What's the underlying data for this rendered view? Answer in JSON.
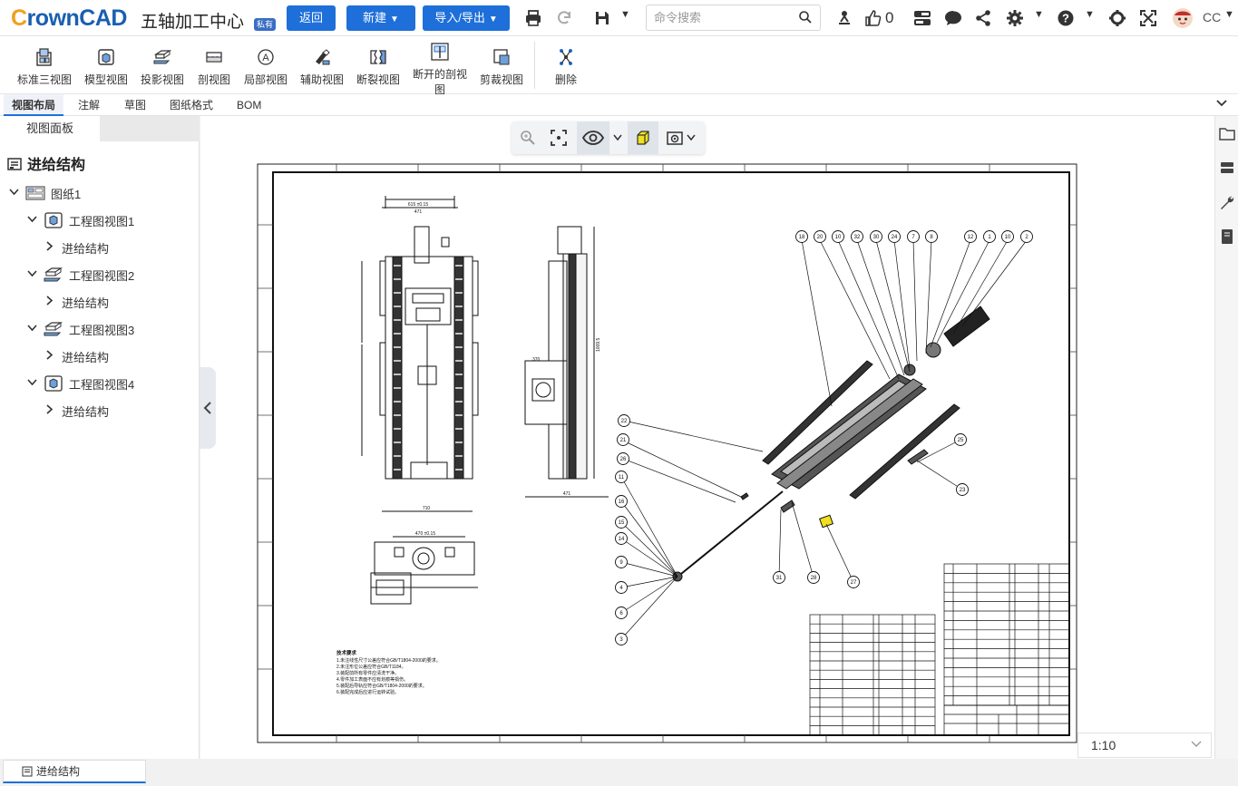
{
  "app": {
    "logo_c": "C",
    "logo_rest": "rownCAD",
    "title": "五轴加工中心",
    "badge": "私有"
  },
  "header": {
    "back_label": "返回",
    "new_label": "新建",
    "import_export_label": "导入/导出",
    "search_placeholder": "命令搜索",
    "like_count": "0",
    "user_name": "CC"
  },
  "toolbar": {
    "items": [
      {
        "label": "标准三视图",
        "icon": "standard-three-view-icon"
      },
      {
        "label": "模型视图",
        "icon": "model-view-icon"
      },
      {
        "label": "投影视图",
        "icon": "projection-view-icon"
      },
      {
        "label": "剖视图",
        "icon": "section-view-icon"
      },
      {
        "label": "局部视图",
        "icon": "detail-view-icon"
      },
      {
        "label": "辅助视图",
        "icon": "auxiliary-view-icon"
      },
      {
        "label": "断裂视图",
        "icon": "broken-view-icon"
      },
      {
        "label": "断开的剖视",
        "label2": "图",
        "icon": "broken-out-section-icon"
      },
      {
        "label": "剪裁视图",
        "icon": "crop-view-icon"
      },
      {
        "label": "删除",
        "icon": "delete-icon"
      }
    ]
  },
  "tabs": [
    {
      "label": "视图布局",
      "active": true
    },
    {
      "label": "注解",
      "active": false
    },
    {
      "label": "草图",
      "active": false
    },
    {
      "label": "图纸格式",
      "active": false
    },
    {
      "label": "BOM",
      "active": false
    }
  ],
  "panel": {
    "tab_label": "视图面板",
    "root_label": "进给结构",
    "tree": {
      "sheet": "图纸1",
      "views": [
        {
          "label": "工程图视图1",
          "child": "进给结构"
        },
        {
          "label": "工程图视图2",
          "child": "进给结构"
        },
        {
          "label": "工程图视图3",
          "child": "进给结构"
        },
        {
          "label": "工程图视图4",
          "child": "进给结构"
        }
      ]
    }
  },
  "drawing": {
    "top_dim": "615 ±0.15",
    "top_dim2": "471",
    "height_dim": "1009.5",
    "width_dim": "710",
    "side_width": "471",
    "plan_width": "470 ±0.15",
    "side_dim": "370",
    "notes_title": "技术要求",
    "notes": [
      "1.未注线性尺寸公差应符合GB/T1804-2000的要求。",
      "2.未注形位公差应符合GB/T1184。",
      "3.装配前所有零件应清洗干净。",
      "4.零件加工表面不应有划痕等损伤。",
      "5.装配后导轨应符合GB/T1804-2000的要求。",
      "6.装配完成后应进行运转试验。"
    ],
    "balloons": [
      "18",
      "20",
      "10",
      "32",
      "30",
      "24",
      "7",
      "8",
      "12",
      "1",
      "10",
      "2",
      "22",
      "21",
      "26",
      "11",
      "16",
      "15",
      "14",
      "9",
      "4",
      "6",
      "3",
      "25",
      "23",
      "31",
      "28",
      "27"
    ]
  },
  "scale": {
    "value": "1:10"
  },
  "bottom": {
    "tab_label": "进给结构"
  },
  "colors": {
    "accent": "#1e6fd9",
    "logo": "#1a5fb0",
    "logo_c": "#f0a020"
  }
}
